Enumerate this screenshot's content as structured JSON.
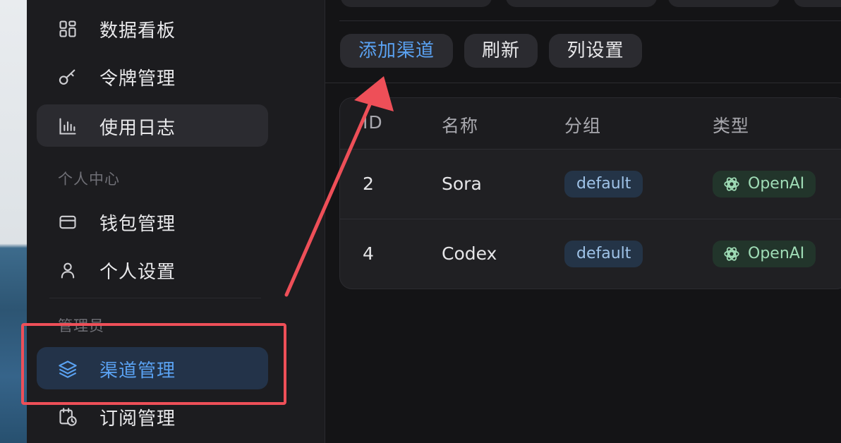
{
  "sidebar": {
    "items_top": [
      {
        "label": "数据看板",
        "icon": "grid-icon"
      },
      {
        "label": "令牌管理",
        "icon": "key-icon"
      },
      {
        "label": "使用日志",
        "icon": "bar-chart-icon"
      }
    ],
    "personal_title": "个人中心",
    "items_personal": [
      {
        "label": "钱包管理",
        "icon": "wallet-icon"
      },
      {
        "label": "个人设置",
        "icon": "user-icon"
      }
    ],
    "admin_title": "管理员",
    "items_admin": [
      {
        "label": "渠道管理",
        "icon": "layers-icon"
      },
      {
        "label": "订阅管理",
        "icon": "calendar-clock-icon"
      }
    ]
  },
  "toolbar": {
    "add_channel": "添加渠道",
    "refresh": "刷新",
    "column_settings": "列设置"
  },
  "table": {
    "headers": [
      "ID",
      "名称",
      "分组",
      "类型"
    ],
    "rows": [
      {
        "id": "2",
        "name": "Sora",
        "group": "default",
        "type": "OpenAI"
      },
      {
        "id": "4",
        "name": "Codex",
        "group": "default",
        "type": "OpenAI"
      }
    ]
  },
  "colors": {
    "accent": "#5aa2f2",
    "annotation": "#ee4f58"
  }
}
